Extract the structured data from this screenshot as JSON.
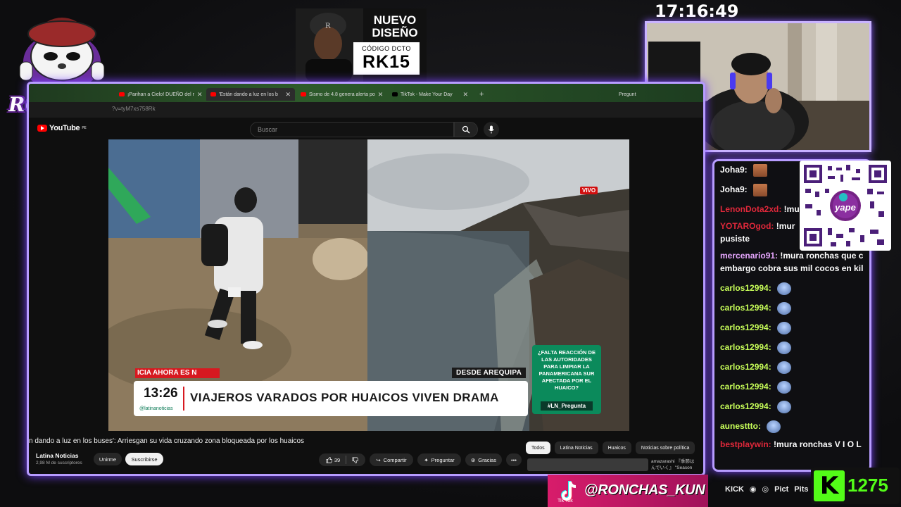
{
  "overlay": {
    "mascot_name": "RONCHAS",
    "clock": "17:16:49",
    "sponsor": {
      "title": "NUEVO\nDISEÑO",
      "code_label": "CÓDIGO DCTO",
      "code": "RK15"
    },
    "tiktok": {
      "platform": "Tik Tok",
      "handle": "@RONCHAS_KUN"
    },
    "socials": [
      "KICK",
      "Pict",
      "Pits"
    ],
    "kick_count": "1275",
    "qr_label": "yape"
  },
  "browser": {
    "tabs": [
      {
        "title": "¡Parihan a Cielo! DUEÑO del r",
        "active": false
      },
      {
        "title": "'Están dando a luz en los b",
        "active": true
      },
      {
        "title": "Sismo de 4.8 genera alerta po",
        "active": false
      },
      {
        "title": "TikTok - Make Your Day",
        "active": false
      },
      {
        "title": "Pregunt",
        "active": false
      }
    ],
    "url": "?v=tyM7xs758Rk",
    "youtube": {
      "logo": "YouTube",
      "region": "PE",
      "search_placeholder": "Buscar"
    },
    "video": {
      "live_badge": "VIVO",
      "ticker": "ICIA AHORA      ES N",
      "location": "DESDE AREQUIPA",
      "time": "13:26",
      "handle": "@latinanoticias",
      "headline": "VIAJEROS VARADOS POR HUAICOS VIVEN DRAMA",
      "poll_question": "¿FALTA REACCIÓN DE\nLAS AUTORIDADES\nPARA LIMPIAR LA\nPANAMERICANA SUR\nAFECTADA POR EL\nHUAICO?",
      "poll_tag": "#LN_Pregunta"
    },
    "title": "n dando a luz en los buses': Arriesgan su vida cruzando zona bloqueada por los huaicos",
    "channel": {
      "name": "Latina Noticias",
      "subscribers": "2,98 M de suscriptores",
      "join_label": "Unirme",
      "subscribe_label": "Suscribirse"
    },
    "actions": {
      "likes": "39",
      "share": "Compartir",
      "ask": "Preguntar",
      "thanks": "Gracias"
    },
    "chips": [
      "Todos",
      "Latina Noticias",
      "Huaicos",
      "Noticias sobre política"
    ],
    "recommendation_snippet": "amazarashi 『季節は\nんでいく』 \"Season"
  },
  "chat": [
    {
      "user": "Joha9:",
      "color": "#ffffff",
      "msg": "",
      "emote": true
    },
    {
      "user": "Joha9:",
      "color": "#ffffff",
      "msg": "",
      "emote": true
    },
    {
      "user": "LenonDota2xd:",
      "color": "#e0283a",
      "msg": " !mur"
    },
    {
      "user": "YOTAROgod:",
      "color": "#e0283a",
      "msg": " !mur"
    },
    {
      "user": "",
      "color": "#ffffff",
      "msg": "pusiste"
    },
    {
      "user": "mercenario91:",
      "color": "#e7a7ff",
      "msg": " !mura ronchas que c"
    },
    {
      "user": "",
      "color": "#ffffff",
      "msg": "embargo cobra sus mil cocos en kil"
    },
    {
      "user": "carlos12994:",
      "color": "#c8ff59",
      "msg": "",
      "emote2": true
    },
    {
      "user": "carlos12994:",
      "color": "#c8ff59",
      "msg": "",
      "emote2": true
    },
    {
      "user": "carlos12994:",
      "color": "#c8ff59",
      "msg": "",
      "emote2": true
    },
    {
      "user": "carlos12994:",
      "color": "#c8ff59",
      "msg": "",
      "emote2": true
    },
    {
      "user": "carlos12994:",
      "color": "#c8ff59",
      "msg": "",
      "emote2": true
    },
    {
      "user": "carlos12994:",
      "color": "#c8ff59",
      "msg": "",
      "emote2": true
    },
    {
      "user": "carlos12994:",
      "color": "#c8ff59",
      "msg": "",
      "emote2": true
    },
    {
      "user": "aunesttto:",
      "color": "#c8ff59",
      "msg": "",
      "emote2": true
    },
    {
      "user": "bestplaywin:",
      "color": "#e0283a",
      "msg": " !mura ronchas V I O L"
    }
  ],
  "colors": {
    "frame_border": "#b79cff",
    "kick_green": "#53fc18",
    "tiktok_pink": "#d81c6b",
    "news_red": "#d71920",
    "poll_green": "#0b8a5b"
  }
}
